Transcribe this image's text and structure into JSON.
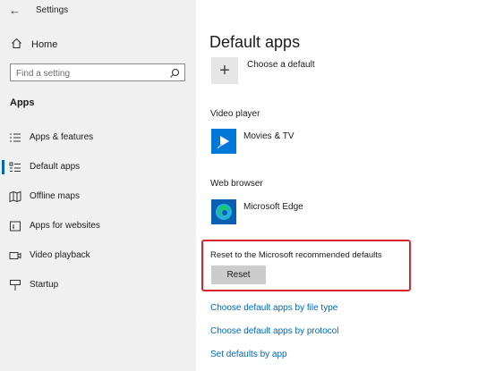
{
  "window": {
    "title": "Settings"
  },
  "sidebar": {
    "home_label": "Home",
    "search_placeholder": "Find a setting",
    "section_title": "Apps",
    "items": [
      {
        "label": "Apps & features",
        "icon": "list-icon",
        "selected": false
      },
      {
        "label": "Default apps",
        "icon": "default-apps-icon",
        "selected": true
      },
      {
        "label": "Offline maps",
        "icon": "map-icon",
        "selected": false
      },
      {
        "label": "Apps for websites",
        "icon": "websites-icon",
        "selected": false
      },
      {
        "label": "Video playback",
        "icon": "video-icon",
        "selected": false
      },
      {
        "label": "Startup",
        "icon": "startup-icon",
        "selected": false
      }
    ]
  },
  "main": {
    "title": "Default apps",
    "choose_default_label": "Choose a default",
    "video_player": {
      "label": "Video player",
      "app_name": "Movies & TV",
      "icon": "movies-tv-icon"
    },
    "web_browser": {
      "label": "Web browser",
      "app_name": "Microsoft Edge",
      "icon": "edge-icon"
    },
    "reset": {
      "description": "Reset to the Microsoft recommended defaults",
      "button_label": "Reset"
    },
    "links": [
      "Choose default apps by file type",
      "Choose default apps by protocol",
      "Set defaults by app"
    ]
  },
  "colors": {
    "accent": "#0067c0",
    "link": "#0067b8",
    "highlight_box": "#d9262e",
    "sidebar_bg": "#f0f0f0"
  }
}
